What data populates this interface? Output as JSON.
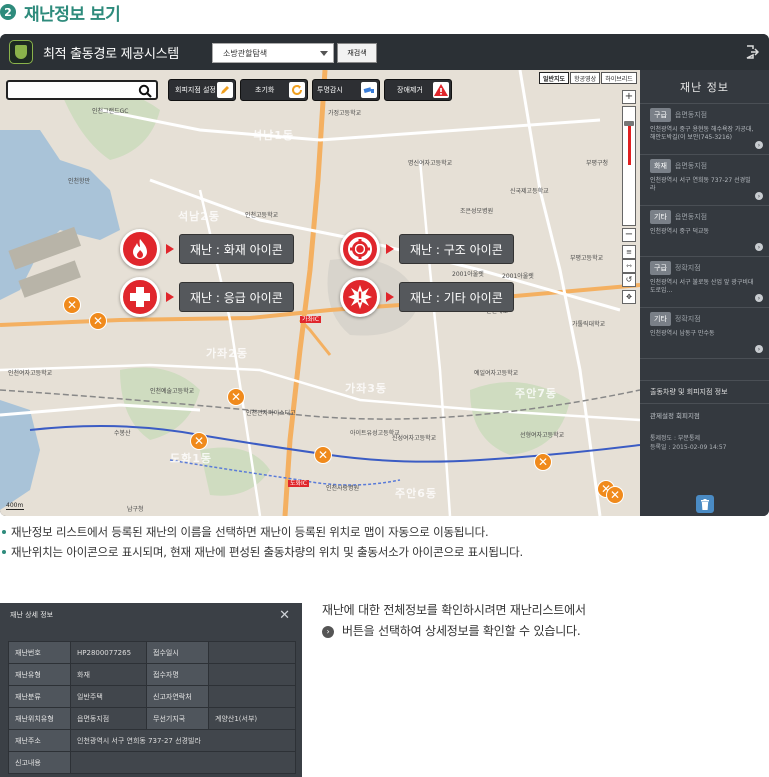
{
  "section": {
    "number": "2",
    "title": "재난정보 보기"
  },
  "app": {
    "title": "최적 출동경로 제공시스템",
    "select_value": "소방관할탐색",
    "search_button": "재검색"
  },
  "map": {
    "search_placeholder": "",
    "tools": [
      {
        "label": "회피지점 설정",
        "icon": "pencil-icon"
      },
      {
        "label": "초기화",
        "icon": "refresh-icon"
      },
      {
        "label": "투명감시",
        "icon": "camera-icon"
      },
      {
        "label": "장애제거",
        "icon": "warning-icon"
      }
    ],
    "map_types": [
      "일반지도",
      "항공영상",
      "하이브리드"
    ],
    "disasters": [
      {
        "label": "재난 : 화재 아이콘",
        "icon": "fire-icon"
      },
      {
        "label": "재난 : 구조 아이콘",
        "icon": "lifebuoy-icon"
      },
      {
        "label": "재난 : 응급 아이콘",
        "icon": "medical-cross-icon"
      },
      {
        "label": "재난 : 기타 아이콘",
        "icon": "burst-icon"
      }
    ],
    "places": [
      "인천그랜드GC",
      "인천항만",
      "가정고등학교",
      "명신여자고등학교",
      "신국제고등학교",
      "부평구청",
      "예일여자고등학교",
      "조은성모병원",
      "인천고등학교",
      "아이트유성고등학교",
      "남구청",
      "인천사랑병원",
      "석남2동",
      "석남1동",
      "가정1동",
      "가정2동",
      "인천대로",
      "2001아울렛",
      "가톨릭대학교",
      "선형여자고등학교",
      "제일고등학교",
      "부평고등학교",
      "인천여자고등학교",
      "인천전자마이스터고",
      "캠아트",
      "부평역",
      "수봉산",
      "인천예술고등학교",
      "신성여자고등학교",
      "가정역",
      "가좌IC",
      "도화IC",
      "가좌2동",
      "가좌3동",
      "가좌4동",
      "주안6동",
      "주안7동",
      "도화1동"
    ],
    "scale": "400m"
  },
  "panel": {
    "title": "재난 정보",
    "items": [
      {
        "badge": "구급",
        "type": "읍면동지점",
        "address": "인천광역시 중구 용현동 해수욕장 가공대, 해안도박길(이 보안(745-3216)"
      },
      {
        "badge": "화재",
        "type": "읍면동지점",
        "address": "인천광역시 서구 연희동 737-27 선경빌라"
      },
      {
        "badge": "기타",
        "type": "읍면동지점",
        "address": "인천광역시 중구 덕교동"
      },
      {
        "badge": "구급",
        "type": "정확지점",
        "address": "인천광역시 서구 불로동 산업 앞 광구비대 도로입..."
      },
      {
        "badge": "기타",
        "type": "정확지점",
        "address": "인천광역시 남동구 만수동"
      }
    ],
    "section2_title": "출동차량 및 회피지점 정보",
    "section2_sub": "관제설정 회피지점",
    "section2_lines": [
      "통제정도 : 부분통제",
      "등록일 : 2015-02-09 14:57"
    ]
  },
  "bullets": [
    "재난정보 리스트에서 등록된 재난의 이름을 선택하면 재난이 등록된 위치로 맵이 자동으로 이동됩니다.",
    "재난위치는 아이콘으로 표시되며, 현재 재난에 편성된 출동차량의 위치 및 출동서소가 아이콘으로 표시됩니다."
  ],
  "dialog": {
    "title": "재난 상세 정보",
    "rows": [
      {
        "l1": "재난번호",
        "v1": "HP2800077265",
        "l2": "접수일시",
        "v2": ""
      },
      {
        "l1": "재난유형",
        "v1": "화재",
        "l2": "접수자명",
        "v2": ""
      },
      {
        "l1": "재난분류",
        "v1": "일반주택",
        "l2": "신고자연락처",
        "v2": ""
      },
      {
        "l1": "재난위치유형",
        "v1": "읍면동지점",
        "l2": "무선기지국",
        "v2": "계양산1(서부)"
      },
      {
        "l1": "재난주소",
        "v1": "인천광역시 서구 연희동 737-27 선경빌라",
        "l2": "",
        "v2": ""
      },
      {
        "l1": "신고내용",
        "v1": "",
        "l2": "",
        "v2": ""
      }
    ]
  },
  "desc": {
    "line1": "재난에 대한 전체정보를 확인하시려면 재난리스트에서",
    "line2": "버튼을 선택하여 상세정보를 확인할 수 있습니다."
  },
  "colors": {
    "accent": "#2e8b7c",
    "disaster_red": "#e0262c",
    "marker_orange": "#f08a1c",
    "panel_bg": "#34393f"
  }
}
